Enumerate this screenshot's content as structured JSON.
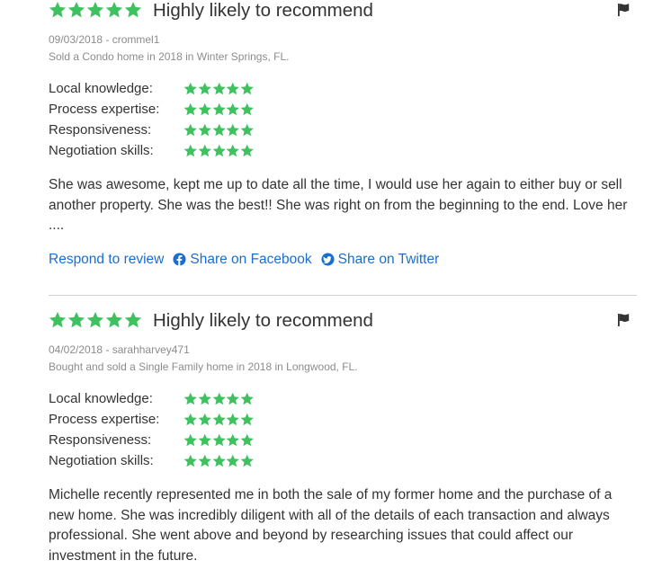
{
  "colors": {
    "star": "#3fc160",
    "link": "#1a6ecf",
    "meta": "#8c8c8c"
  },
  "icons": {
    "star": "star-icon",
    "flag": "flag-icon",
    "facebook": "facebook-icon",
    "twitter": "twitter-icon"
  },
  "reviews": [
    {
      "overall_rating": 5,
      "headline": "Highly likely to recommend",
      "date_user": "09/03/2018 - crommel1",
      "transaction": "Sold a Condo home in 2018 in Winter Springs, FL.",
      "ratings": [
        {
          "label": "Local knowledge:",
          "value": 5
        },
        {
          "label": "Process expertise:",
          "value": 5
        },
        {
          "label": "Responsiveness:",
          "value": 5
        },
        {
          "label": "Negotiation skills:",
          "value": 5
        }
      ],
      "text": "She was awesome, kept me up to date all the time, I would use her again to either buy or sell another property. She was the best!! She was right on from the beginning to the end. Love her ....",
      "actions": {
        "respond": "Respond to review",
        "facebook": "Share on Facebook",
        "twitter": "Share on Twitter"
      }
    },
    {
      "overall_rating": 5,
      "headline": "Highly likely to recommend",
      "date_user": "04/02/2018 - sarahharvey471",
      "transaction": "Bought and sold a Single Family home in 2018 in Longwood, FL.",
      "ratings": [
        {
          "label": "Local knowledge:",
          "value": 5
        },
        {
          "label": "Process expertise:",
          "value": 5
        },
        {
          "label": "Responsiveness:",
          "value": 5
        },
        {
          "label": "Negotiation skills:",
          "value": 5
        }
      ],
      "text": "Michelle recently represented me in both the sale of my former home and the purchase of a new home.  She was incredibly diligent with all of the details of each transaction and always professional.  She went above and beyond by researching issues that could affect our investment in the future."
    }
  ]
}
